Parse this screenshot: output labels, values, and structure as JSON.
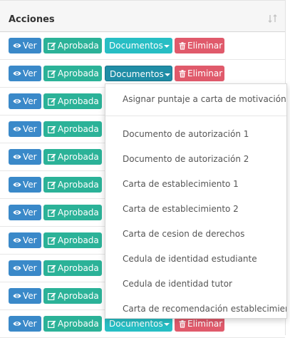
{
  "header": {
    "title": "Acciones"
  },
  "buttons": {
    "ver": "Ver",
    "aprobada": "Aprobada",
    "documentos": "Documentos",
    "eliminar": "Eliminar"
  },
  "dropdown": {
    "items": [
      "Asignar puntaje a carta de motivación",
      "Documento de autorización 1",
      "Documento de autorización 2",
      "Carta de establecimiento 1",
      "Carta de establecimiento 2",
      "Carta de cesion de derechos",
      "Cedula de identidad estudiante",
      "Cedula de identidad tutor",
      "Carta de recomendación establecimiento"
    ]
  },
  "colors": {
    "ver": "#3a89c9",
    "aprobada": "#2bb298",
    "documentos": "#27bec4",
    "documentos_active": "#1f8da6",
    "eliminar": "#e05a6b"
  },
  "icons": [
    "sort-icon",
    "eye-icon",
    "edit-icon",
    "caret-down-icon",
    "trash-icon"
  ]
}
